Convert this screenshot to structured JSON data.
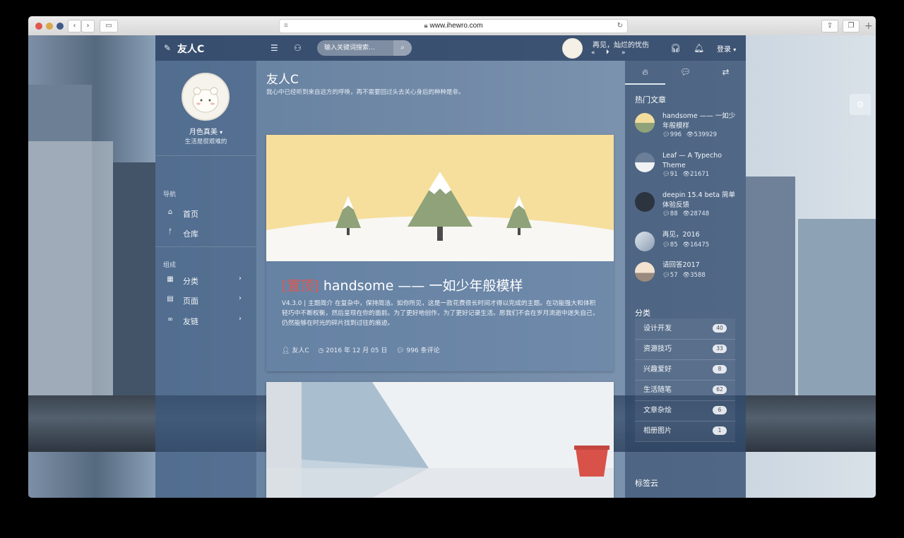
{
  "browser": {
    "url": "www.ihewro.com"
  },
  "header": {
    "logo_text": "友人C",
    "search_placeholder": "输入关键词搜索…",
    "music_title": "再见，灿烂的忧伤",
    "login_label": "登录",
    "login_caret": "▾"
  },
  "profile": {
    "name": "月色真美",
    "name_caret": "▾",
    "motto": "生活是很艰难的"
  },
  "nav": {
    "section_nav": "导航",
    "items_nav": [
      {
        "icon": "home-icon",
        "label": "首页"
      },
      {
        "icon": "repo-icon",
        "label": "仓库"
      }
    ],
    "section_group": "组成",
    "items_group": [
      {
        "icon": "grid-icon",
        "label": "分类"
      },
      {
        "icon": "file-icon",
        "label": "页面"
      },
      {
        "icon": "link-icon",
        "label": "友链"
      }
    ]
  },
  "site": {
    "title": "友人C",
    "subtitle": "我心中已经听到来自远方的呼唤，再不需要回过头去关心身后的种种是非。"
  },
  "post": {
    "sticky_tag": "[置顶]",
    "title": "handsome —— 一如少年般模样",
    "excerpt": "V4.3.0 | 主题简介 在复杂中，保持简洁。如你所见，这是一款花费很长时间才得以完成的主题。在功能强大和体积轻巧中不断权衡，然后呈现在你的面前。为了更好地创作，为了更好记录生活。愿我们不会在岁月流逝中迷失自己，仍然能够在时光的碎片找到过往的痕迹。",
    "author": "友人C",
    "date": "2016 年 12 月 05 日",
    "comments": "996 条评论"
  },
  "sidebar": {
    "hot_title": "热门文章",
    "hot_posts": [
      {
        "title": "handsome —— 一如少年般模样",
        "comments": "996",
        "views": "539929"
      },
      {
        "title": "Leaf — A Typecho Theme",
        "comments": "91",
        "views": "21671"
      },
      {
        "title": "deepin 15.4 beta 简单体验反馈",
        "comments": "88",
        "views": "28748"
      },
      {
        "title": "再见，2016",
        "comments": "85",
        "views": "16475"
      },
      {
        "title": "请回答2017",
        "comments": "57",
        "views": "3588"
      }
    ],
    "cat_title": "分类",
    "categories": [
      {
        "label": "设计开发",
        "count": "40"
      },
      {
        "label": "资源技巧",
        "count": "33"
      },
      {
        "label": "兴趣爱好",
        "count": "8"
      },
      {
        "label": "生活随笔",
        "count": "62"
      },
      {
        "label": "文章杂烩",
        "count": "6"
      },
      {
        "label": "相册图片",
        "count": "1"
      }
    ],
    "tag_title": "标签云"
  }
}
